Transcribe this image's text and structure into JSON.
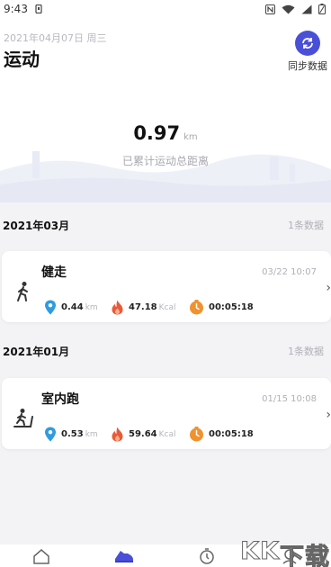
{
  "status_bar": {
    "time": "9:43"
  },
  "header": {
    "date": "2021年04月07日 周三",
    "title": "运动",
    "sync_label": "同步数据"
  },
  "summary": {
    "distance_value": "0.97",
    "distance_unit": "km",
    "caption": "已累计运动总距离"
  },
  "months": [
    {
      "label": "2021年03月",
      "count": "1条数据",
      "record": {
        "name": "健走",
        "activity_icon": "walking-icon",
        "datetime": "03/22 10:07",
        "distance": "0.44",
        "distance_unit": "km",
        "calories": "47.18",
        "calories_unit": "Kcal",
        "duration": "00:05:18"
      }
    },
    {
      "label": "2021年01月",
      "count": "1条数据",
      "record": {
        "name": "室内跑",
        "activity_icon": "treadmill-icon",
        "datetime": "01/15 10:08",
        "distance": "0.53",
        "distance_unit": "km",
        "calories": "59.64",
        "calories_unit": "Kcal",
        "duration": "00:05:18"
      }
    }
  ],
  "watermark": [
    "K",
    "K",
    "下",
    "载"
  ],
  "colors": {
    "accent": "#4a4fd8",
    "location": "#2f9be0",
    "fire": "#e85a3a",
    "timer": "#f0922e"
  }
}
